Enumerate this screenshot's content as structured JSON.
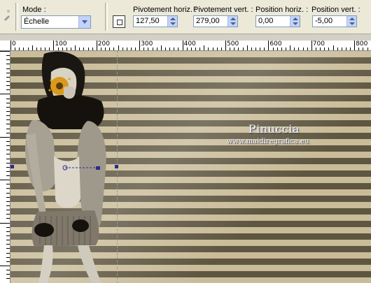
{
  "toolbar": {
    "mode_label": "Mode :",
    "mode_value": "Échelle",
    "pivot_h_label": "Pivotement horiz. :",
    "pivot_h_value": "127,50",
    "pivot_v_label": "Pivotement vert. :",
    "pivot_v_value": "279,00",
    "pos_h_label": "Position horiz. :",
    "pos_h_value": "0,00",
    "pos_v_label": "Position vert. :",
    "pos_v_value": "-5,00"
  },
  "ruler": {
    "labels": [
      "0",
      "100",
      "200",
      "300",
      "400",
      "500",
      "600",
      "700",
      "800"
    ]
  },
  "watermark": {
    "name": "Pinuccia",
    "site": "www.maidiregrafica.eu"
  },
  "colors": {
    "stripe_light": "#c9bc98",
    "stripe_dark": "#5e5641",
    "handle": "#2b2b8a",
    "accent_orange": "#d99a1a"
  }
}
